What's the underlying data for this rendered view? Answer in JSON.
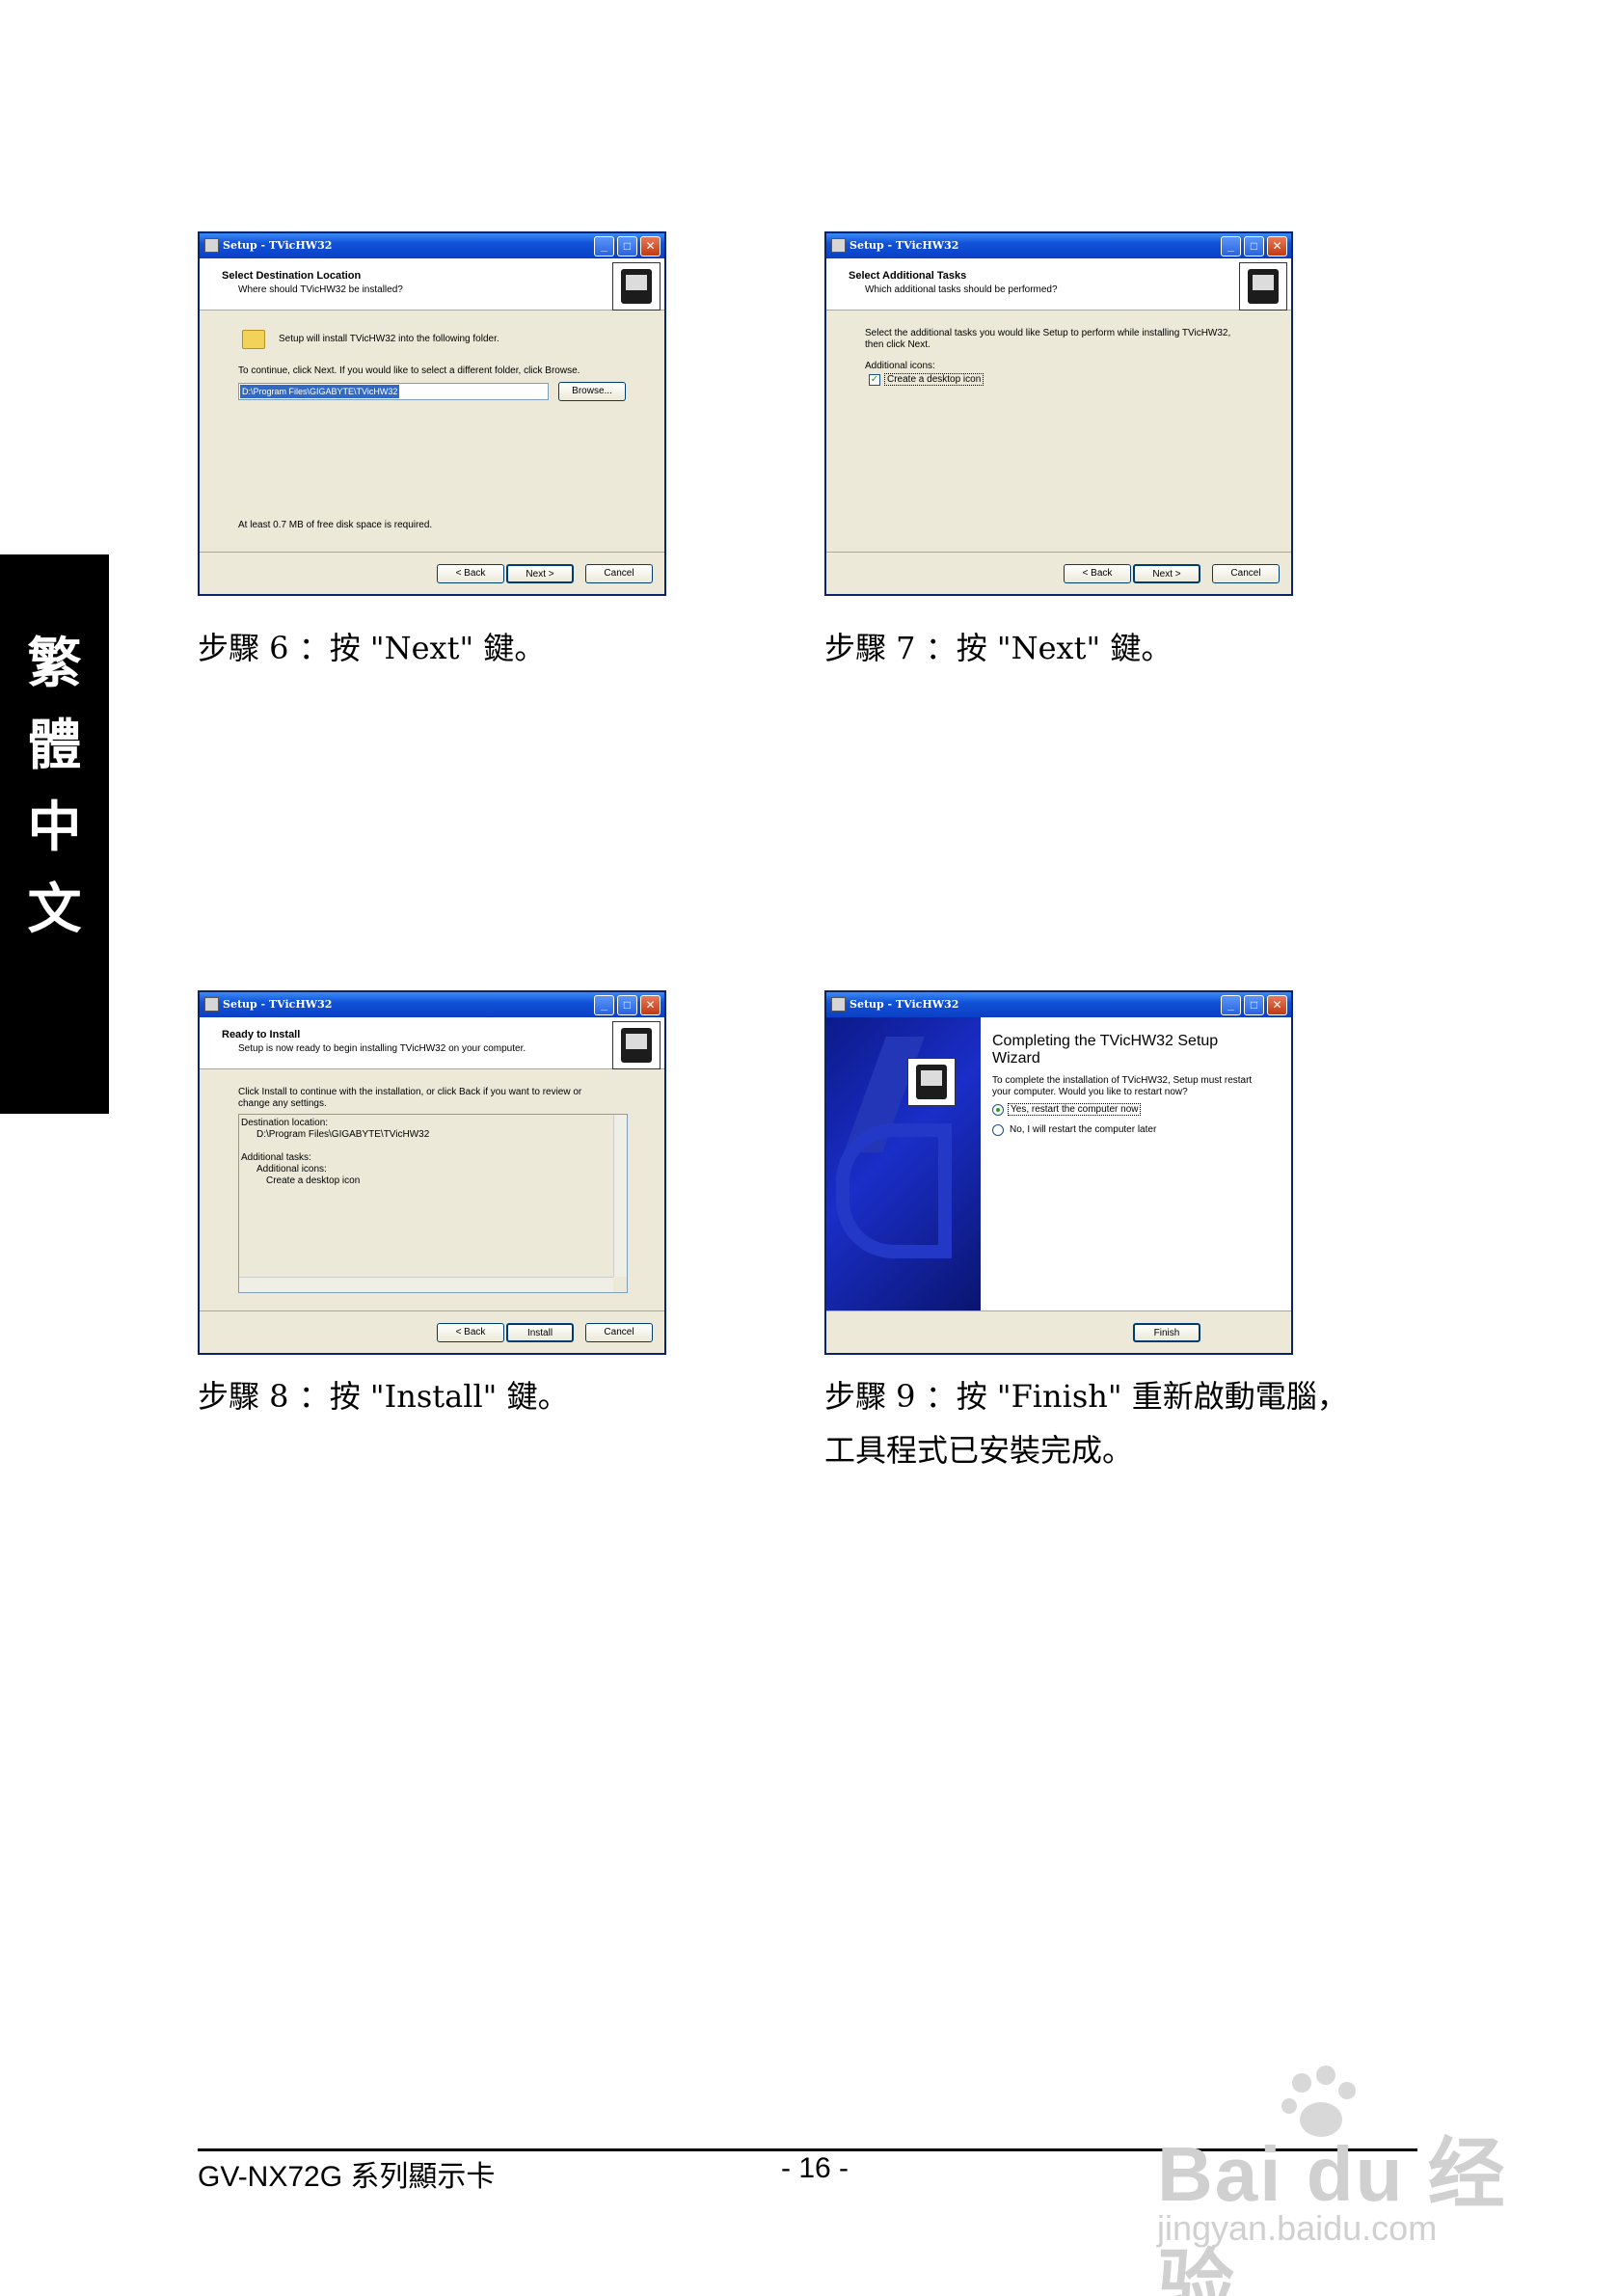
{
  "side_tab": [
    "繁",
    "體",
    "中",
    "文"
  ],
  "dialogs": {
    "d6": {
      "title": "Setup - TVicHW32",
      "header_title": "Select Destination Location",
      "header_sub": "Where should TVicHW32 be installed?",
      "line1": "Setup will install TVicHW32 into the following folder.",
      "line2": "To continue, click Next. If you would like to select a different folder, click Browse.",
      "path": "D:\\Program Files\\GIGABYTE\\TVicHW32",
      "browse": "Browse...",
      "disk": "At least 0.7 MB of free disk space is required.",
      "back": "< Back",
      "next": "Next >",
      "cancel": "Cancel"
    },
    "d7": {
      "title": "Setup - TVicHW32",
      "header_title": "Select Additional Tasks",
      "header_sub": "Which additional tasks should be performed?",
      "line1": "Select the additional tasks you would like Setup to perform while installing TVicHW32,",
      "line2": "then click Next.",
      "icons_label": "Additional icons:",
      "checkbox_label": "Create a desktop icon",
      "back": "< Back",
      "next": "Next >",
      "cancel": "Cancel"
    },
    "d8": {
      "title": "Setup - TVicHW32",
      "header_title": "Ready to Install",
      "header_sub": "Setup is now ready to begin installing TVicHW32 on your computer.",
      "line1": "Click Install to continue with the installation, or click Back if you want to review or",
      "line2": "change any settings.",
      "list": [
        "Destination location:",
        "D:\\Program Files\\GIGABYTE\\TVicHW32",
        "",
        "Additional tasks:",
        "Additional icons:",
        "Create a desktop icon"
      ],
      "back": "< Back",
      "install": "Install",
      "cancel": "Cancel"
    },
    "d9": {
      "title": "Setup - TVicHW32",
      "heading1": "Completing the TVicHW32 Setup",
      "heading2": "Wizard",
      "line1": "To complete the installation of TVicHW32, Setup must restart",
      "line2": "your computer. Would you like to restart now?",
      "radio_yes": "Yes, restart the computer now",
      "radio_no": "No, I will restart the computer later",
      "finish": "Finish"
    }
  },
  "captions": {
    "c6": "步驟 6 ：按 \"Next\" 鍵。",
    "c7": "步驟 7 ：按 \"Next\" 鍵。",
    "c8": "步驟 8 ：按 \"Install\" 鍵。",
    "c9a": "步驟 9 ：按 \"Finish\" 重新啟動電腦，",
    "c9b": "工具程式已安裝完成。"
  },
  "footer": {
    "model": "GV-NX72G",
    "model_zh": "系列顯示卡",
    "page": "- 16 -"
  },
  "watermark": {
    "brand": "Bai du 经验",
    "url": "jingyan.baidu.com"
  }
}
